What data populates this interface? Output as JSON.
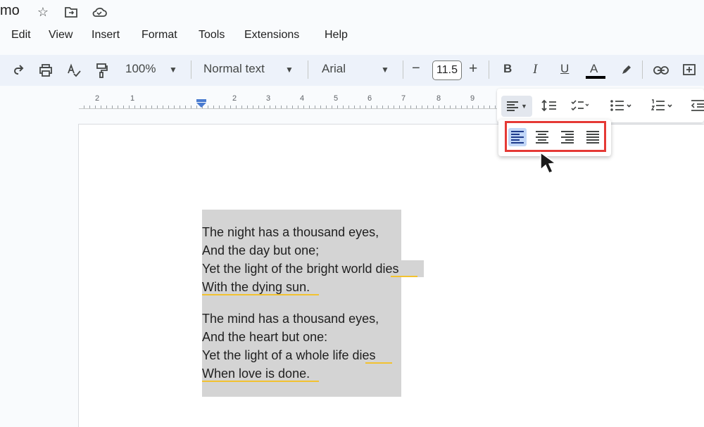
{
  "title": {
    "doc_name": "mo",
    "icons": [
      "star-icon",
      "move-to-folder-icon",
      "cloud-saved-icon"
    ]
  },
  "menu": [
    "Edit",
    "View",
    "Insert",
    "Format",
    "Tools",
    "Extensions",
    "Help"
  ],
  "toolbar": {
    "zoom": "100%",
    "style": "Normal text",
    "font": "Arial",
    "font_size": "11.5",
    "minus": "−",
    "plus": "+",
    "bold": "B",
    "italic": "I",
    "underline": "U",
    "text_color": "A",
    "text_color_value": "#000000"
  },
  "ruler": {
    "numbers": [
      "2",
      "1",
      "1",
      "2",
      "3",
      "4",
      "5",
      "6",
      "7",
      "8",
      "9"
    ]
  },
  "align_popup": {
    "options": [
      "left-align-icon",
      "center-align-icon",
      "right-align-icon",
      "justify-icon"
    ],
    "selected": "left-align-icon",
    "highlight_color": "#e53935"
  },
  "document": {
    "stanza1": [
      "The night has a thousand eyes,",
      "And the day but one;",
      "Yet the light of the bright world dies",
      "With the dying sun."
    ],
    "stanza2": [
      "The mind has a thousand eyes,",
      "And the heart but one:",
      "Yet the light of a whole life dies",
      "When love is done."
    ]
  }
}
